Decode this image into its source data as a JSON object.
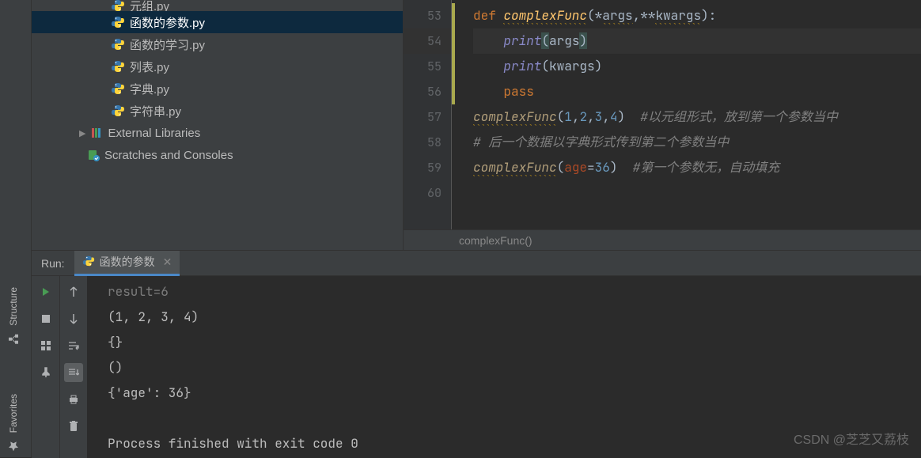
{
  "project_tree": {
    "partial_item": "元组.py",
    "items": [
      {
        "name": "函数的参数.py",
        "selected": true
      },
      {
        "name": "函数的学习.py",
        "selected": false
      },
      {
        "name": "列表.py",
        "selected": false
      },
      {
        "name": "字典.py",
        "selected": false
      },
      {
        "name": "字符串.py",
        "selected": false
      }
    ],
    "external_libraries": "External Libraries",
    "scratches": "Scratches and Consoles"
  },
  "editor": {
    "line_numbers": [
      "53",
      "54",
      "55",
      "56",
      "57",
      "58",
      "59",
      "60"
    ],
    "lines": [
      {
        "indent": "",
        "tokens": [
          {
            "t": "kw",
            "v": "def "
          },
          {
            "t": "fn uw",
            "v": "complexFunc"
          },
          {
            "t": "op",
            "v": "(*"
          },
          {
            "t": "param uw",
            "v": "args"
          },
          {
            "t": "op",
            "v": ",**"
          },
          {
            "t": "param uw",
            "v": "kwargs"
          },
          {
            "t": "op",
            "v": "):"
          }
        ]
      },
      {
        "indent": "    ",
        "tokens": [
          {
            "t": "builtin",
            "v": "print"
          },
          {
            "t": "op hl",
            "v": "("
          },
          {
            "t": "param",
            "v": "args"
          },
          {
            "t": "op hl",
            "v": ")"
          }
        ]
      },
      {
        "indent": "    ",
        "tokens": [
          {
            "t": "builtin",
            "v": "print"
          },
          {
            "t": "op",
            "v": "("
          },
          {
            "t": "param",
            "v": "kwargs"
          },
          {
            "t": "op",
            "v": ")"
          }
        ]
      },
      {
        "indent": "    ",
        "tokens": [
          {
            "t": "kw",
            "v": "pass"
          }
        ]
      },
      {
        "indent": "",
        "tokens": [
          {
            "t": "fncall uw",
            "v": "complexFunc"
          },
          {
            "t": "op",
            "v": "("
          },
          {
            "t": "num",
            "v": "1"
          },
          {
            "t": "op",
            "v": ","
          },
          {
            "t": "num",
            "v": "2"
          },
          {
            "t": "op",
            "v": ","
          },
          {
            "t": "num",
            "v": "3"
          },
          {
            "t": "op",
            "v": ","
          },
          {
            "t": "num",
            "v": "4"
          },
          {
            "t": "op",
            "v": ")  "
          },
          {
            "t": "comment",
            "v": "#以元组形式，放到第一个参数当中"
          }
        ]
      },
      {
        "indent": "",
        "tokens": [
          {
            "t": "comment",
            "v": "# 后一个数据以字典形式传到第二个参数当中"
          }
        ]
      },
      {
        "indent": "",
        "tokens": [
          {
            "t": "fncall uw",
            "v": "complexFunc"
          },
          {
            "t": "op",
            "v": "("
          },
          {
            "t": "named",
            "v": "age"
          },
          {
            "t": "op",
            "v": "="
          },
          {
            "t": "num",
            "v": "36"
          },
          {
            "t": "op",
            "v": ")  "
          },
          {
            "t": "comment",
            "v": "#第一个参数无，自动填充"
          }
        ]
      },
      {
        "indent": "",
        "tokens": []
      }
    ],
    "breadcrumb": "complexFunc()"
  },
  "run_panel": {
    "label": "Run:",
    "tab_name": "函数的参数",
    "output": [
      {
        "text": "result=6",
        "faded": true
      },
      {
        "text": "(1, 2, 3, 4)",
        "faded": false
      },
      {
        "text": "{}",
        "faded": false
      },
      {
        "text": "()",
        "faded": false
      },
      {
        "text": "{'age': 36}",
        "faded": false
      },
      {
        "text": "",
        "faded": false
      },
      {
        "text": "Process finished with exit code 0",
        "faded": false
      }
    ]
  },
  "sidebar_tabs": {
    "structure": "Structure",
    "favorites": "Favorites"
  },
  "watermark": "CSDN @芝芝又荔枝"
}
